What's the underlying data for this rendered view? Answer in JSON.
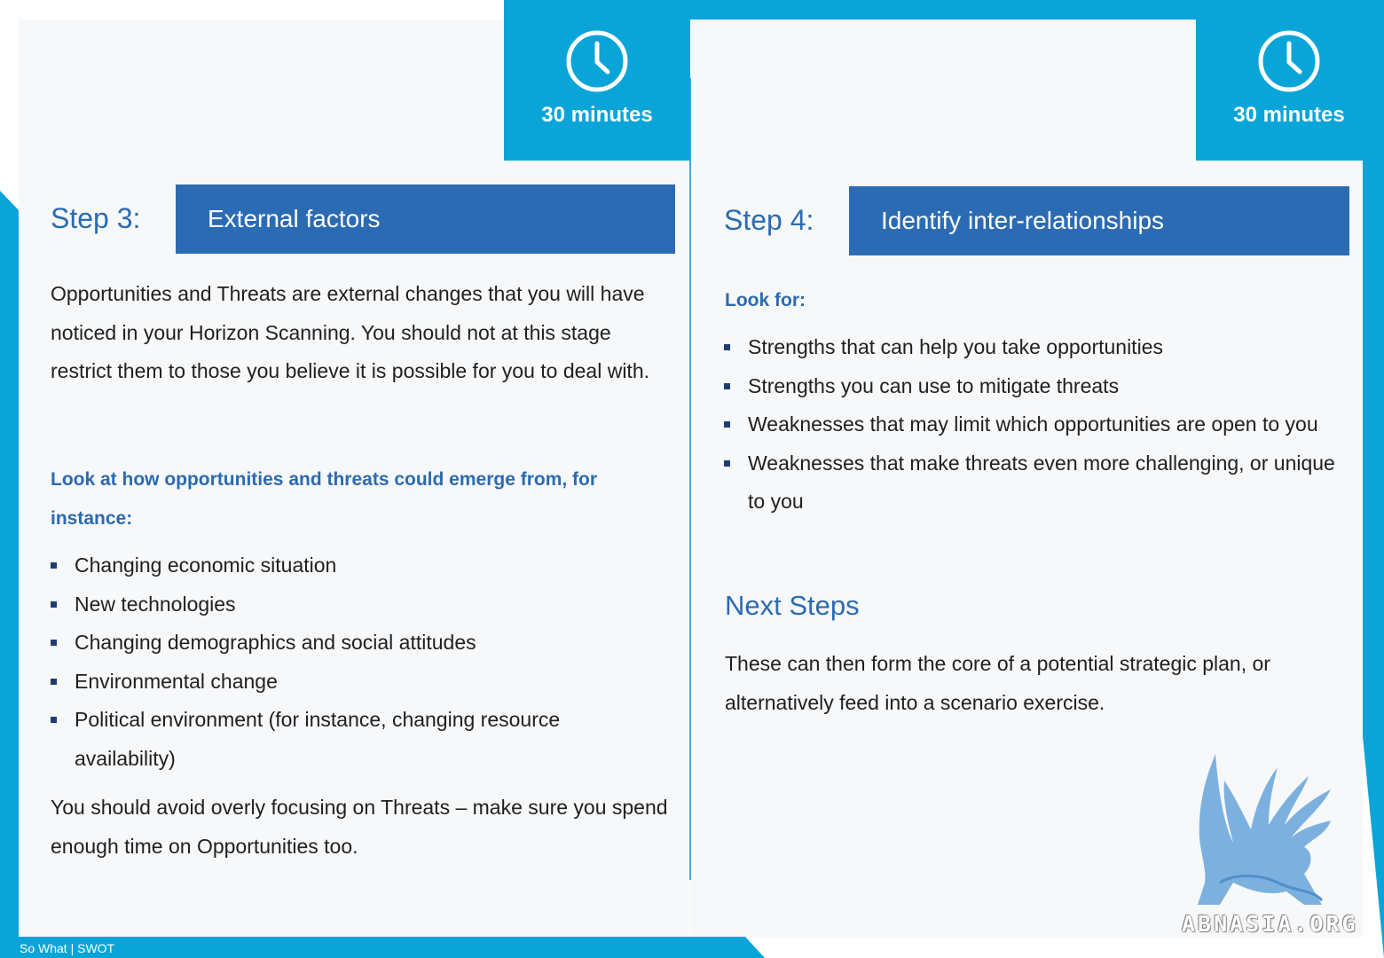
{
  "colors": {
    "accent": "#0aa5d8",
    "header_bar": "#2b6bb3",
    "heading_text": "#2b6bb0"
  },
  "footer": {
    "text": "So What | SWOT"
  },
  "left": {
    "timer": {
      "icon": "clock-icon",
      "label": "30 minutes"
    },
    "step_label": "Step 3:",
    "step_title": "External factors",
    "intro": "Opportunities and Threats are external changes that you will have noticed in your Horizon Scanning. You should not at this stage restrict them to those you believe it is possible for you to deal with.",
    "subheading": "Look at how opportunities and threats could emerge from, for instance:",
    "bullets": [
      "Changing economic situation",
      "New technologies",
      "Changing demographics and social attitudes",
      "Environmental change",
      "Political environment (for instance, changing resource availability)"
    ],
    "closing": "You should avoid overly focusing on Threats – make sure you spend enough time on Opportunities too."
  },
  "right": {
    "timer": {
      "icon": "clock-icon",
      "label": "30 minutes"
    },
    "step_label": "Step 4:",
    "step_title": "Identify inter-relationships",
    "subheading": "Look for:",
    "bullets": [
      "Strengths that can help you take opportunities",
      "Strengths you can use to mitigate threats",
      "Weaknesses that may limit which opportunities are open to you",
      "Weaknesses that make threats even more challenging, or unique to you"
    ],
    "next_heading": "Next Steps",
    "next_text": "These can then form the core of a potential strategic plan, or alternatively feed into a scenario exercise."
  },
  "logo": {
    "icon": "griffin-logo"
  },
  "watermark": {
    "text": "ABNASIA.ORG"
  }
}
